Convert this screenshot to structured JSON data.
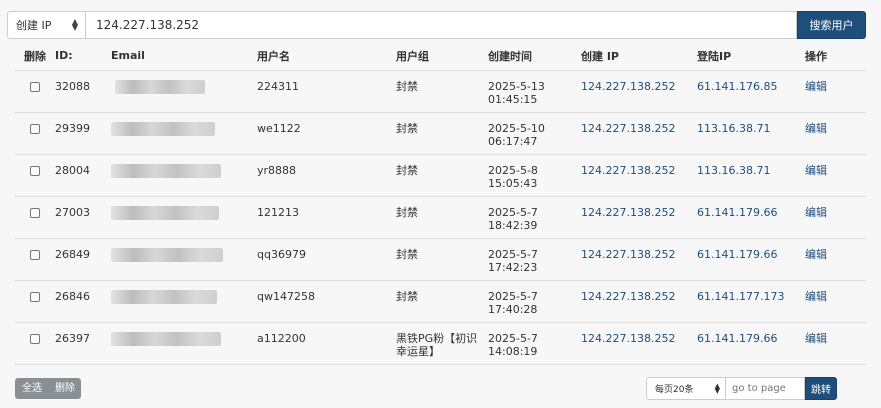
{
  "search": {
    "type_selected": "创建 IP",
    "value": "124.227.138.252",
    "button_label": "搜索用户"
  },
  "table": {
    "headers": {
      "delete": "删除",
      "id": "ID:",
      "email": "Email",
      "username": "用户名",
      "group": "用户组",
      "created": "创建时间",
      "create_ip": "创建 IP",
      "login_ip": "登陆IP",
      "action": "操作"
    },
    "rows": [
      {
        "id": "32088",
        "username": "224311",
        "group": "封禁",
        "date": "2025-5-13",
        "time": "01:45:15",
        "create_ip": "124.227.138.252",
        "login_ip": "61.141.176.85",
        "action": "编辑"
      },
      {
        "id": "29399",
        "username": "we1122",
        "group": "封禁",
        "date": "2025-5-10",
        "time": "06:17:47",
        "create_ip": "124.227.138.252",
        "login_ip": "113.16.38.71",
        "action": "编辑"
      },
      {
        "id": "28004",
        "username": "yr8888",
        "group": "封禁",
        "date": "2025-5-8",
        "time": "15:05:43",
        "create_ip": "124.227.138.252",
        "login_ip": "113.16.38.71",
        "action": "编辑"
      },
      {
        "id": "27003",
        "username": "121213",
        "group": "封禁",
        "date": "2025-5-7",
        "time": "18:42:39",
        "create_ip": "124.227.138.252",
        "login_ip": "61.141.179.66",
        "action": "编辑"
      },
      {
        "id": "26849",
        "username": "qq36979",
        "group": "封禁",
        "date": "2025-5-7",
        "time": "17:42:23",
        "create_ip": "124.227.138.252",
        "login_ip": "61.141.179.66",
        "action": "编辑"
      },
      {
        "id": "26846",
        "username": "qw147258",
        "group": "封禁",
        "date": "2025-5-7",
        "time": "17:40:28",
        "create_ip": "124.227.138.252",
        "login_ip": "61.141.177.173",
        "action": "编辑"
      },
      {
        "id": "26397",
        "username": "a112200",
        "group": "黑铁PG粉【初识幸运星】",
        "date": "2025-5-7",
        "time": "14:08:19",
        "create_ip": "124.227.138.252",
        "login_ip": "61.141.179.66",
        "action": "编辑"
      }
    ]
  },
  "footer": {
    "select_all": "全选",
    "delete": "删除",
    "per_page": "每页20条",
    "goto_placeholder": "go to page",
    "goto_button": "跳转"
  },
  "colors": {
    "link": "#1f4e7a",
    "primary_button": "#1f4e7a",
    "secondary_button": "#8a8f94"
  }
}
